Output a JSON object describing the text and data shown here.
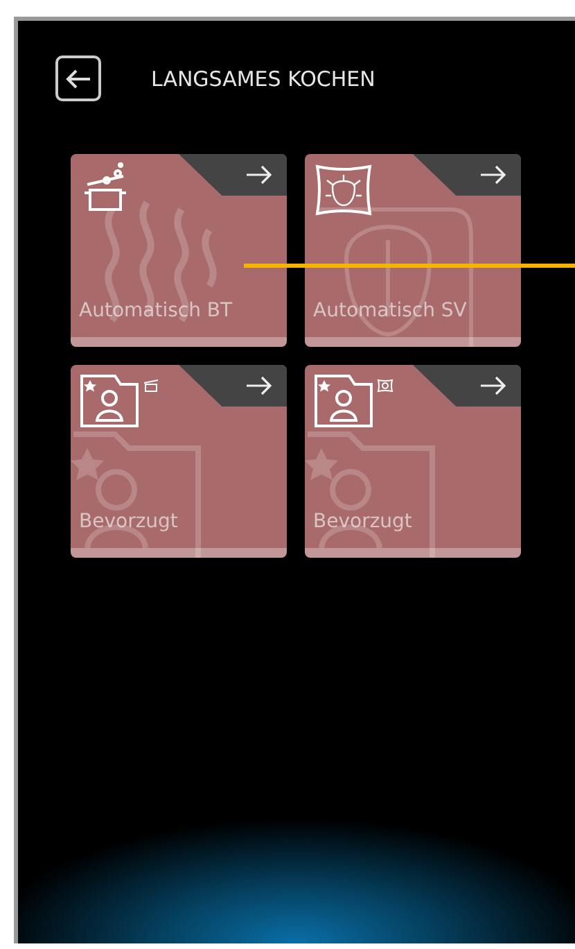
{
  "header": {
    "title": "LANGSAMES KOCHEN"
  },
  "tiles": [
    {
      "label": "Automatisch BT",
      "kind": "pot"
    },
    {
      "label": "Automatisch SV",
      "kind": "apple"
    },
    {
      "label": "Bevorzugt",
      "kind": "favpot"
    },
    {
      "label": "Bevorzugt",
      "kind": "favapple"
    }
  ]
}
